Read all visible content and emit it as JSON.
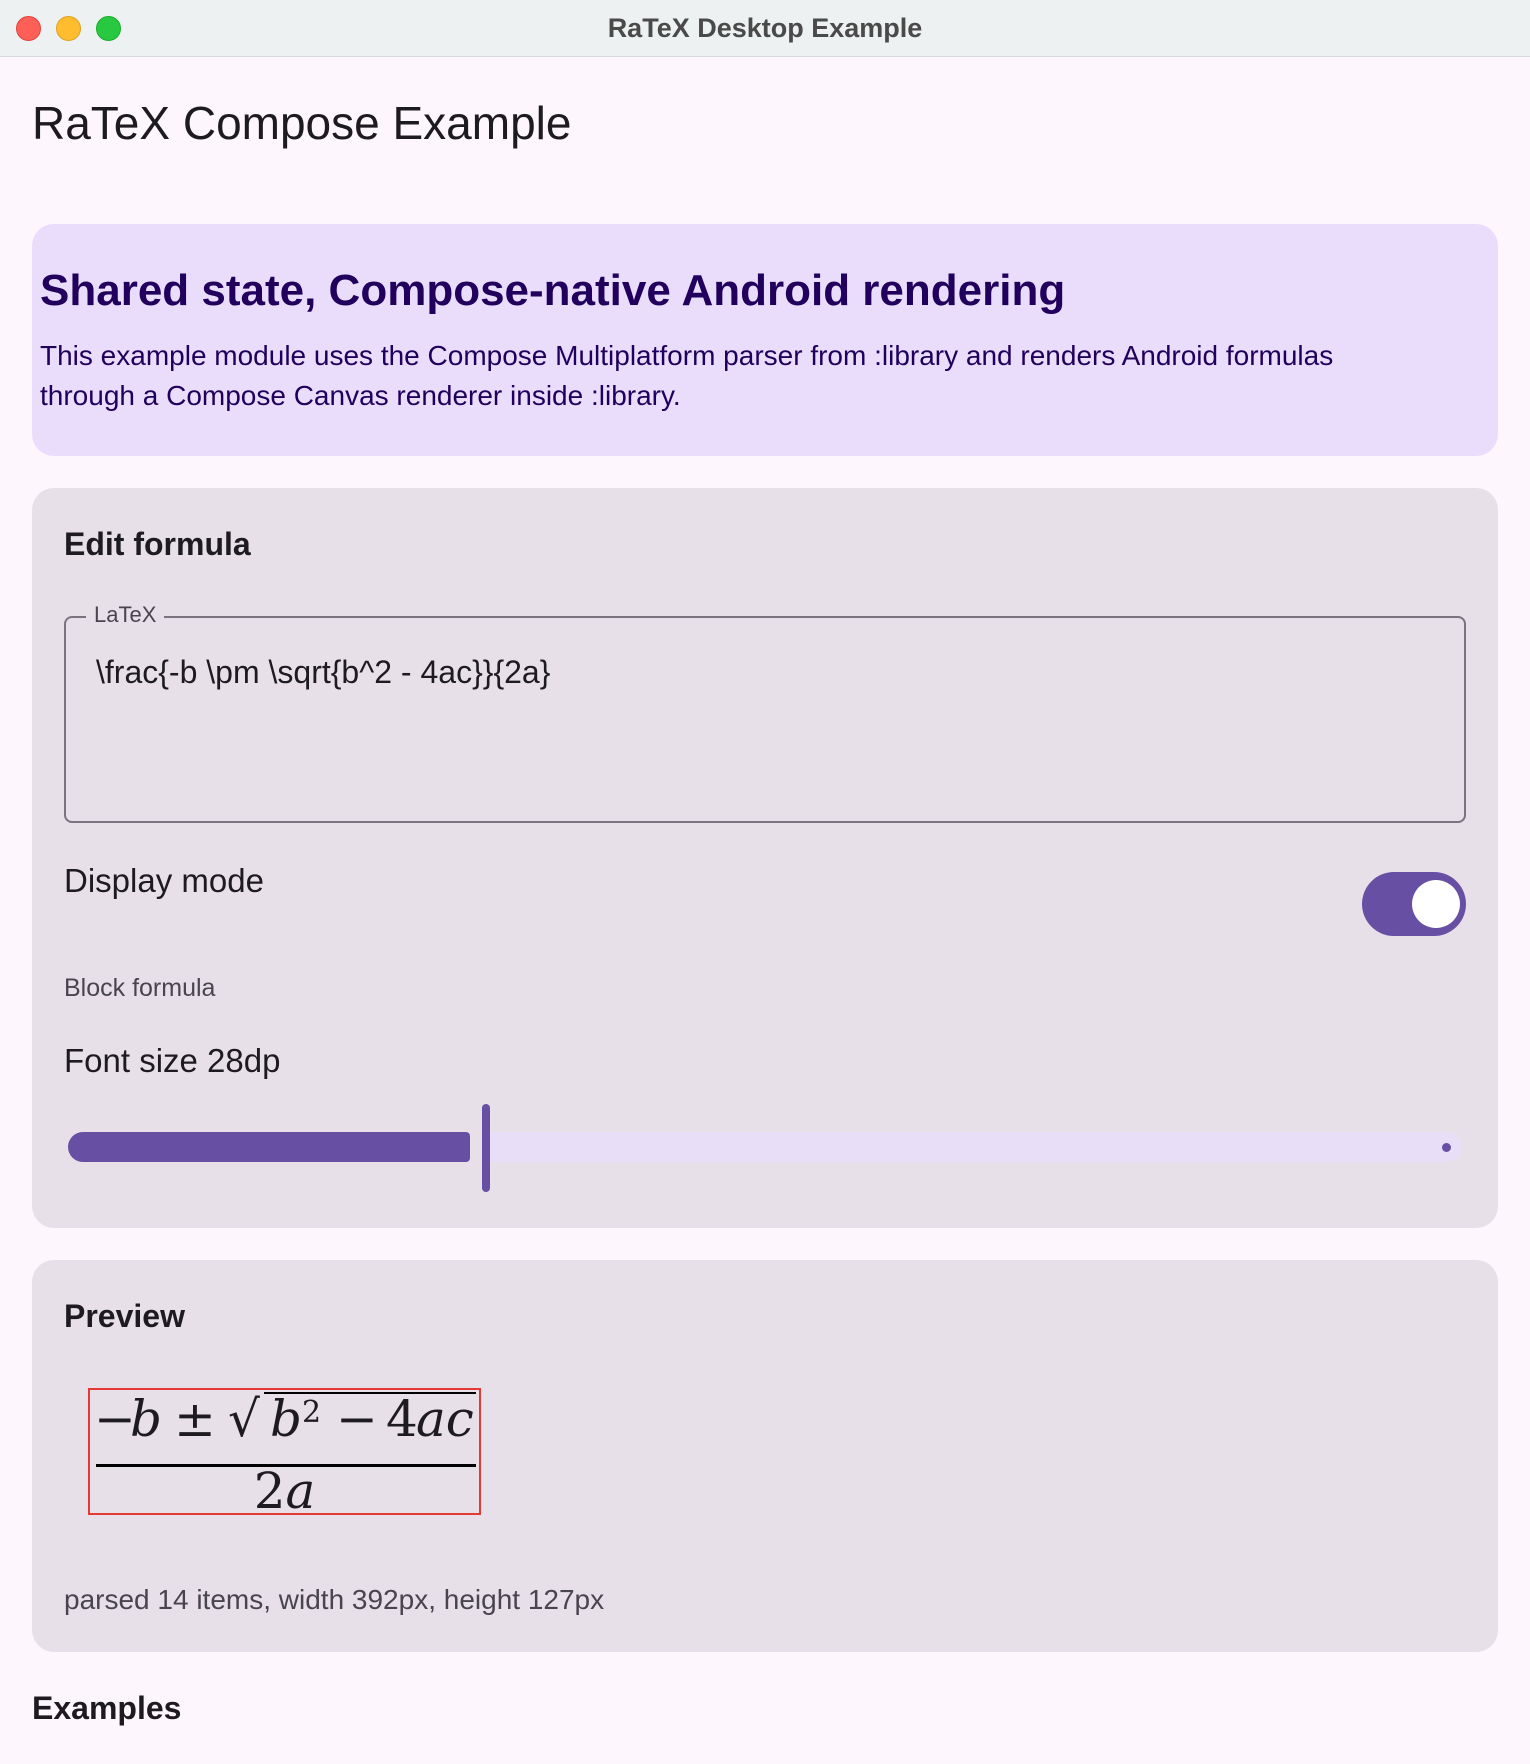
{
  "window": {
    "title": "RaTeX Desktop Example"
  },
  "app": {
    "title": "RaTeX Compose Example"
  },
  "info": {
    "title": "Shared state, Compose-native Android rendering",
    "body": "This example module uses the Compose Multiplatform parser from :library and renders Android formulas through a Compose Canvas renderer inside :library."
  },
  "edit": {
    "title": "Edit formula",
    "field_label": "LaTeX",
    "latex_value": "\\frac{-b \\pm \\sqrt{b^2 - 4ac}}{2a}",
    "display_mode_label": "Display mode",
    "display_mode_on": true,
    "display_mode_caption": "Block formula",
    "font_size_label": "Font size 28dp",
    "font_size_fraction": 0.3
  },
  "preview": {
    "title": "Preview",
    "formula": {
      "numerator_minus": "−",
      "numerator_b": "b",
      "plus_minus": "±",
      "sqrt": "√",
      "b": "b",
      "exp": "2",
      "minus": "−",
      "four": "4",
      "ac": "ac",
      "denominator_2": "2",
      "denominator_a": "a"
    },
    "stats": "parsed 14 items, width 392px, height 127px"
  },
  "examples": {
    "title": "Examples"
  },
  "colors": {
    "primary": "#6750a4",
    "info_card": "#e9ddfb",
    "surface_card": "#e7e0e8",
    "background": "#fdf7fd",
    "debug_outline": "#e53935"
  }
}
